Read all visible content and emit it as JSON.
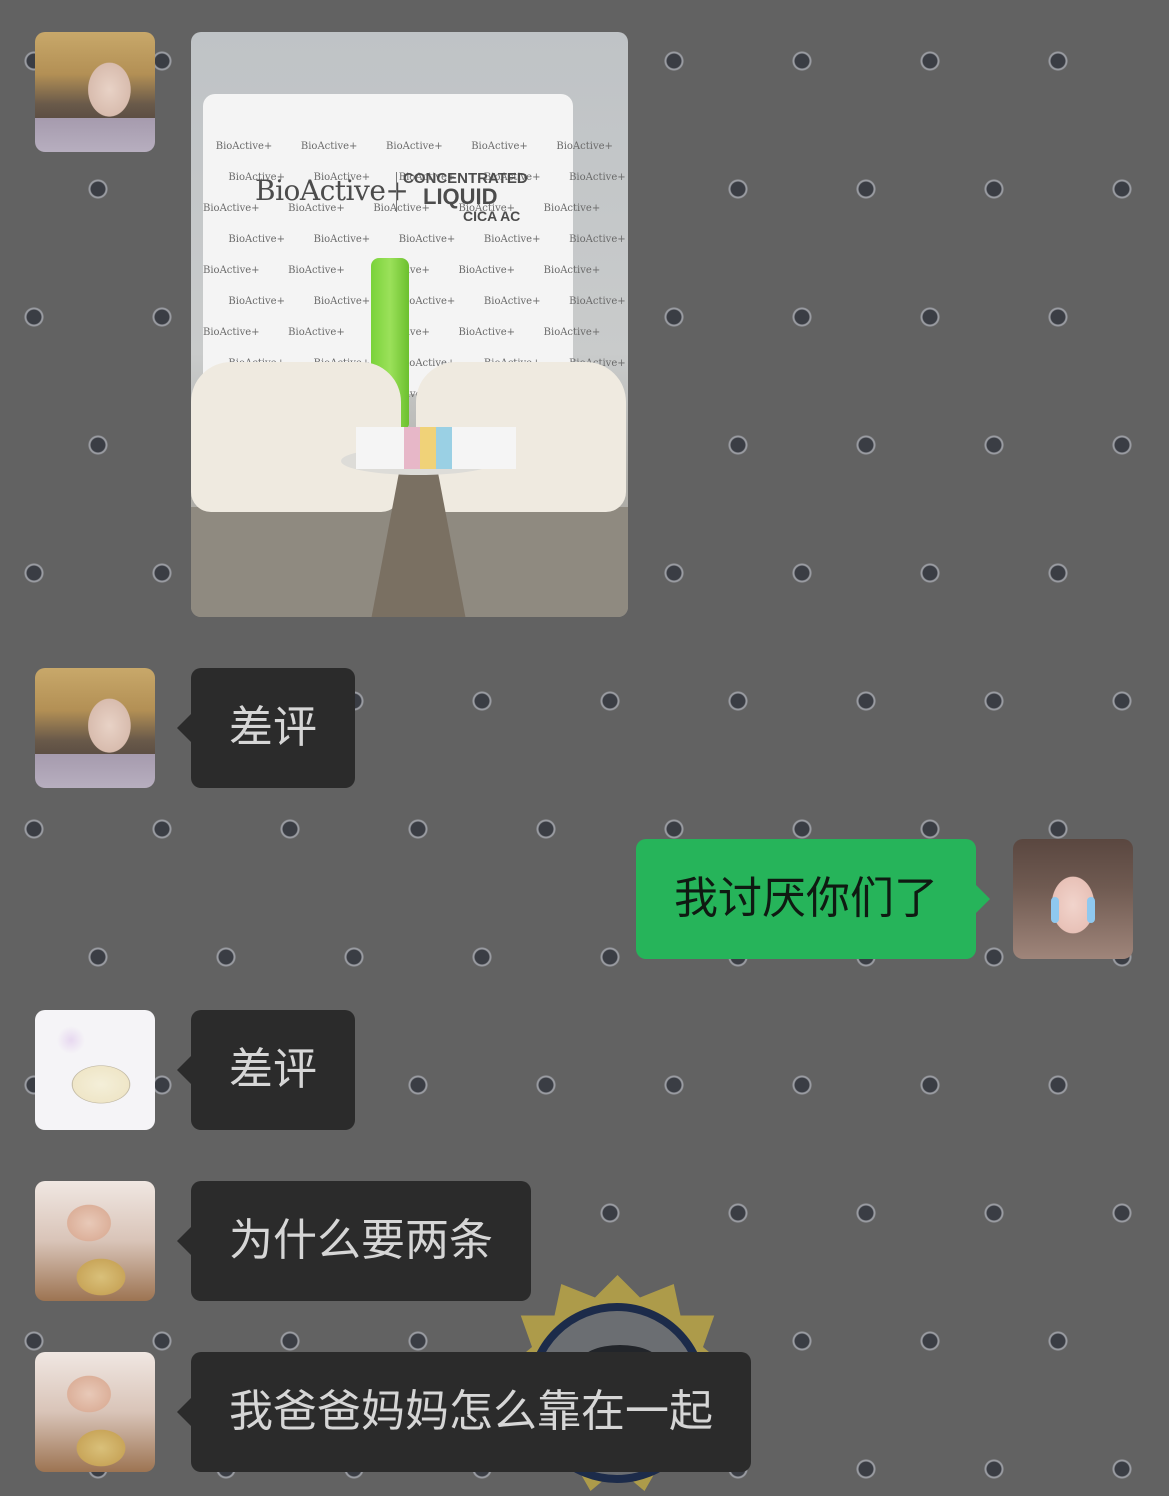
{
  "chat": {
    "messages": [
      {
        "sender": "blonde",
        "type": "image",
        "image": {
          "brand": "BioActive+",
          "product_line_1": "CONCENTRATED",
          "product_line_2": "LIQUID",
          "product_line_3": "CICA AC"
        }
      },
      {
        "sender": "blonde",
        "type": "text",
        "text": "差评"
      },
      {
        "sender": "me",
        "type": "text",
        "text": "我讨厌你们了"
      },
      {
        "sender": "cartoon",
        "type": "text",
        "text": "差评"
      },
      {
        "sender": "boy",
        "type": "text",
        "text": "为什么要两条"
      },
      {
        "sender": "boy",
        "type": "text",
        "text": "我爸爸妈妈怎么靠在一起"
      }
    ]
  },
  "theme": {
    "background": "#626262",
    "incoming_bubble": "#2b2b2b",
    "outgoing_bubble": "#26b45a"
  }
}
